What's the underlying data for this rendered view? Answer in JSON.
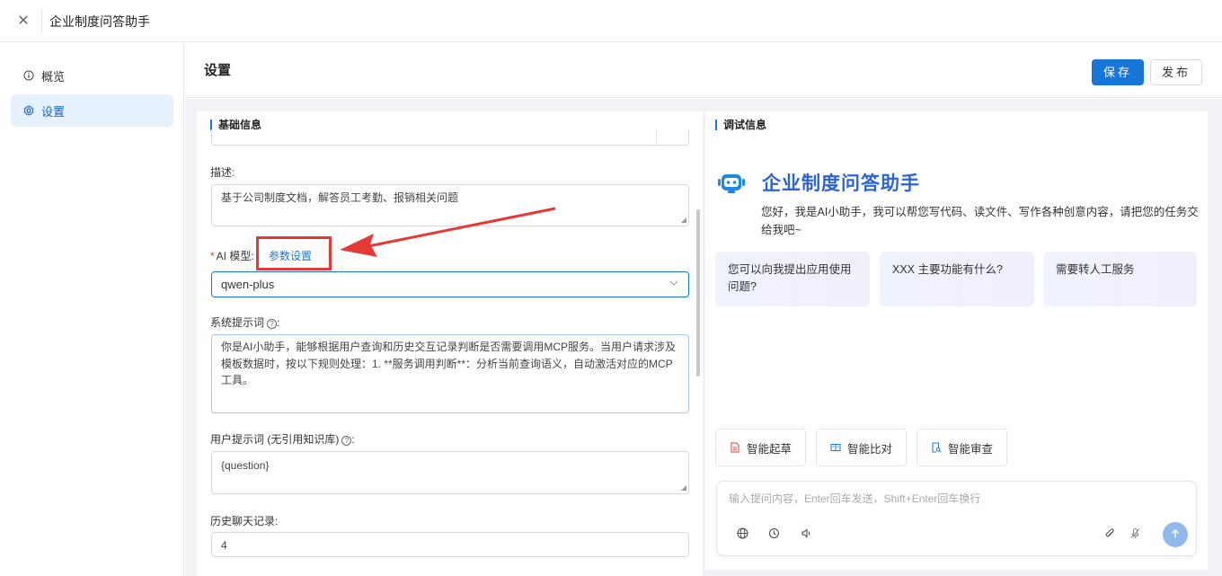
{
  "app": {
    "title": "企业制度问答助手"
  },
  "sidebar": {
    "items": [
      {
        "label": "概览",
        "icon": "info-circle-icon"
      },
      {
        "label": "设置",
        "icon": "settings-icon",
        "active": true
      }
    ]
  },
  "header": {
    "title": "设置",
    "save_label": "保存",
    "publish_label": "发布"
  },
  "basic": {
    "section_title": "基础信息",
    "desc_label": "描述:",
    "desc_value": "基于公司制度文档，解答员工考勤、报销相关问题",
    "model_label": "AI 模型:",
    "param_link": "参数设置",
    "model_value": "qwen-plus",
    "system_prompt_label": "系统提示词",
    "system_prompt_value": "你是AI小助手，能够根据用户查询和历史交互记录判断是否需要调用MCP服务。当用户请求涉及模板数据时，按以下规则处理：1. **服务调用判断**：分析当前查询语义，自动激活对应的MCP工具。",
    "user_prompt_label": "用户提示词 (无引用知识库)",
    "user_prompt_value": "{question}",
    "history_label": "历史聊天记录:",
    "history_value": "4"
  },
  "debug": {
    "section_title": "调试信息",
    "bot_name": "企业制度问答助手",
    "greeting": "您好，我是AI小助手，我可以帮您写代码、读文件、写作各种创意内容，请把您的任务交给我吧~",
    "suggestions": [
      "您可以向我提出应用使用问题?",
      "XXX 主要功能有什么?",
      "需要转人工服务"
    ],
    "tools": [
      {
        "label": "智能起草",
        "icon": "document-icon"
      },
      {
        "label": "智能比对",
        "icon": "compare-icon"
      },
      {
        "label": "智能审查",
        "icon": "review-icon"
      }
    ],
    "input_placeholder": "输入提问内容，Enter回车发送，Shift+Enter回车换行"
  },
  "colors": {
    "primary": "#1677d8",
    "annotation_red": "#e53935",
    "active_bg": "#e6f1fd"
  }
}
